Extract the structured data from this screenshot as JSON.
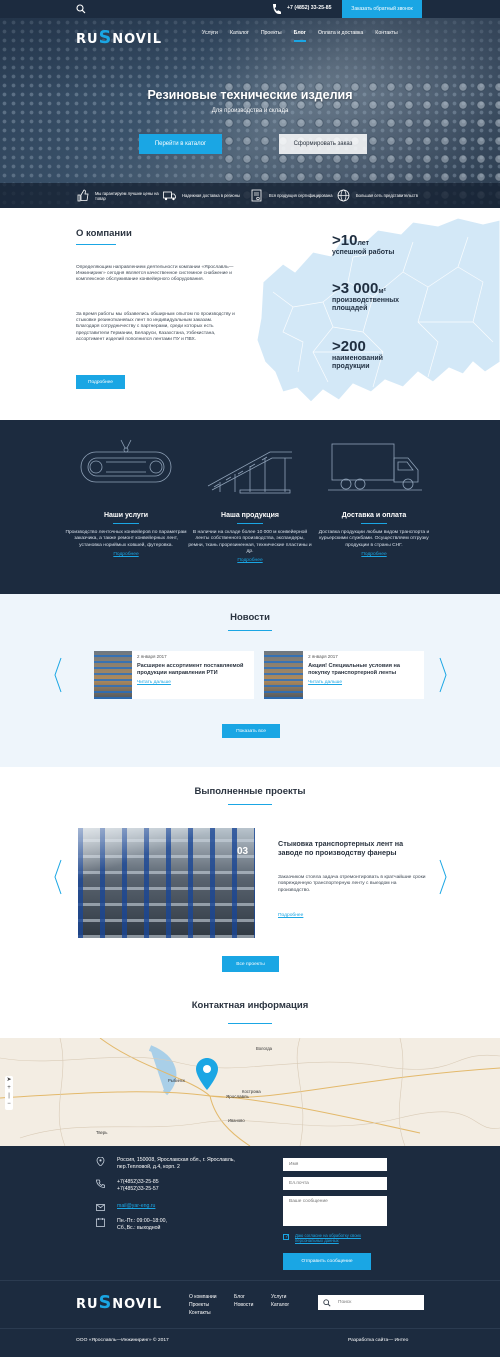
{
  "topbar": {
    "phone": "+7 (4852) 33-25-85",
    "callback_button": "Заказать обратный звонок",
    "icons": [
      "search-icon",
      "phone-icon"
    ]
  },
  "header": {
    "logo_left": "RU",
    "logo_s": "S",
    "logo_right": "NOVIL",
    "nav": [
      "Услуги",
      "Каталог",
      "Проекты",
      "Блог",
      "Оплата и доставка",
      "Контакты"
    ],
    "active_nav": "Блог"
  },
  "hero": {
    "title": "Резиновые технические изделия",
    "subtitle": "Для производства и склада",
    "catalog_button": "Перейти в каталог",
    "order_button": "Сформировать заказ"
  },
  "features": [
    {
      "icon": "thumb-up-icon",
      "text": "Мы гарантируем лучшие цены на товар"
    },
    {
      "icon": "truck-icon",
      "text": "Надежная доставка в регионы"
    },
    {
      "icon": "certificate-icon",
      "text": "Вся продукция сертифицирована"
    },
    {
      "icon": "globe-icon",
      "text": "Большая сеть представительств"
    }
  ],
  "about": {
    "title": "О компании",
    "paragraph1": "Определяющим направлением деятельности компании «Ярославль—Инжиниринг» сегодня является качественное системное снабжение и комплексное обслуживание конвейерного оборудования.",
    "paragraph2": "За время работы мы обзавелись обширным опытом по производству и стыковке резинотканевых лент по индивидуальным заказам. Благодаря сотрудничеству с партнерами, среди которых есть представители Германии, Беларуси, Казахстана, Узбекистана, ассортимент изделий пополнился лентами ПУ и ПВХ.",
    "more_button": "Подробнее",
    "stats": [
      {
        "prefix": ">",
        "value": "10",
        "unit": "лет",
        "label": "успешной работы"
      },
      {
        "prefix": ">",
        "value": "3 000",
        "unit": "м²",
        "label": "производственных площадей"
      },
      {
        "prefix": ">",
        "value": "200",
        "unit": "",
        "label": "наименований продукции"
      }
    ]
  },
  "services": [
    {
      "title": "Наши услуги",
      "text": "Производство ленточных конвейеров по параметрам заказчика, а также ремонт конвейерных лент, установка нориймых ковшей, футеровка.",
      "link": "Подробнее"
    },
    {
      "title": "Наша продукция",
      "text": "В наличии на складе более 10 000 м конвейерной ленты собственного производства, экспандеры, ремни, ткань прорезиненная, технические пластины и др.",
      "link": "Подробнее"
    },
    {
      "title": "Доставка и оплата",
      "text": "Доставка продукции любым видом транспорта и курьерскими службами. Осуществляем отгрузку продукции в страны СНГ.",
      "link": "Подробнее"
    }
  ],
  "news": {
    "title": "Новости",
    "items": [
      {
        "date": "2 января 2017",
        "title": "Расширен ассортимент поставляемой продукции направления РТИ",
        "link": "Читать дальше"
      },
      {
        "date": "2 января 2017",
        "title": "Акция! Специальные условия на покупку транспортерной ленты",
        "link": "Читать дальше"
      }
    ],
    "show_all": "Показать все"
  },
  "projects": {
    "title": "Выполненные проекты",
    "number": "03",
    "item_title": "Стыковка транспортерных лент на заводе по производству фанеры",
    "item_text": "Заказчиком стояла задача отремонтировать в кратчайшие сроки поврежденную транспортерную ленту с выездом на производство.",
    "item_link": "Подробнее",
    "all_button": "Все проекты"
  },
  "contacts": {
    "title": "Контактная информация",
    "map_labels": [
      "Ярославль",
      "Кострома",
      "Иваново",
      "Тверь",
      "Вологда",
      "Рыбинск"
    ],
    "address": "Россия, 150008, Ярославская обл., г. Ярославль, пер.Тепловой, д.4, корп. 2",
    "phone1": "+7(4852)33-25-85",
    "phone2": "+7(4852)33-25-57",
    "email": "mail@yar-eng.ru",
    "hours1": "Пн.-Пт.: 09:00–18:00,",
    "hours2": "Сб.,Вс.: выходной",
    "form": {
      "name_placeholder": "Имя",
      "email_placeholder": "Ел.почта",
      "message_placeholder": "Ваше сообщение",
      "consent": "Даю согласие на обработку своих персональных данных",
      "send_button": "Отправить сообщение"
    }
  },
  "footer": {
    "col1": [
      "О компании",
      "Проекты",
      "Контакты"
    ],
    "col2": [
      "Блог",
      "Новости"
    ],
    "col3": [
      "Услуги",
      "Каталог"
    ],
    "search_placeholder": "Поиск",
    "copyright": "ООО «Ярославль—Инжиниринг» © 2017",
    "developer": "Разработка сайта— Интео"
  },
  "colors": {
    "accent": "#1aa6e4",
    "dark": "#1c2b3f",
    "light_bg": "#eef5fb"
  }
}
